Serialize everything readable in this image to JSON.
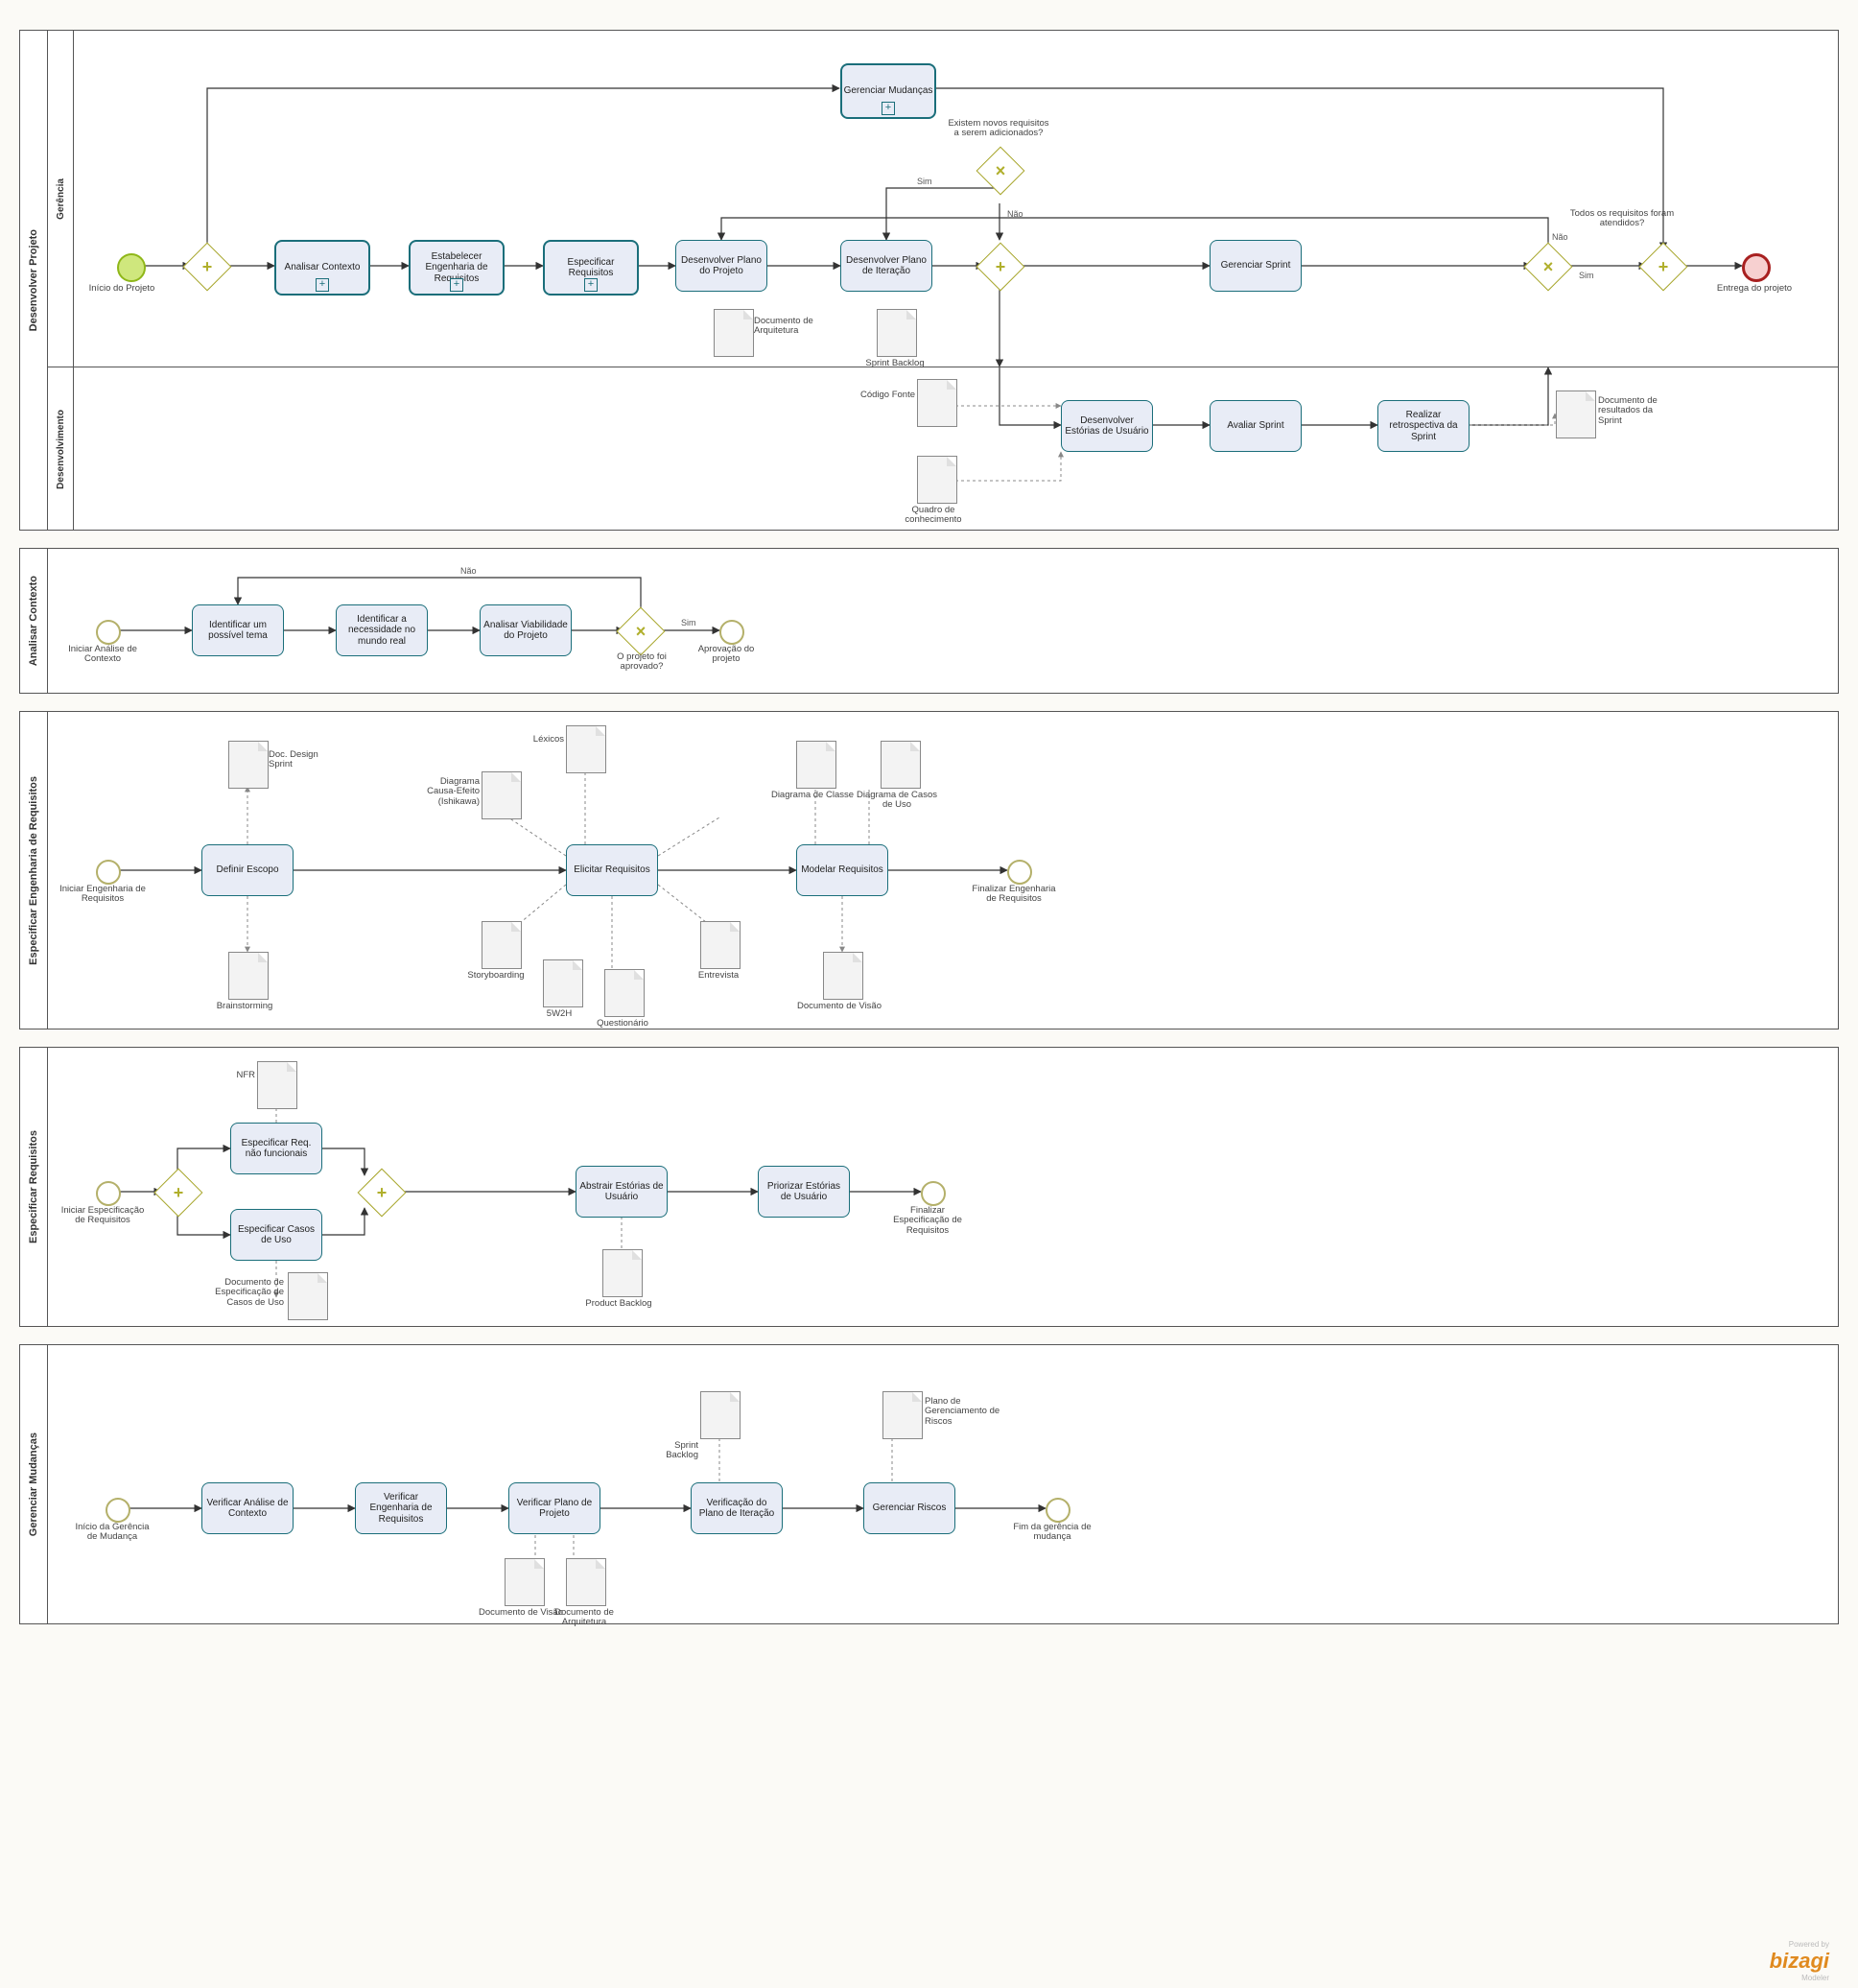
{
  "brand": {
    "name": "bizagi",
    "sub": "Modeler",
    "powered": "Powered by"
  },
  "pool1": {
    "title": "Desenvolver Projeto",
    "lanes": [
      "Gerência",
      "Desenvolvimento"
    ],
    "startLabel": "Início do Projeto",
    "endLabel": "Entrega do projeto",
    "q1": "Existem novos requisitos a serem adicionados?",
    "q2": "Todos os requisitos foram atendidos?",
    "sim": "Sim",
    "nao": "Não",
    "tasks": {
      "gm": "Gerenciar Mudanças",
      "ac": "Analisar Contexto",
      "eer": "Estabelecer Engenharia de Requisitos",
      "er": "Especificar Requisitos",
      "dpp": "Desenvolver Plano do Projeto",
      "dpi": "Desenvolver Plano de Iteração",
      "gs": "Gerenciar Sprint",
      "deu": "Desenvolver Estórias de Usuário",
      "as": "Avaliar Sprint",
      "rrs": "Realizar retrospectiva da Sprint"
    },
    "docs": {
      "arq": "Documento de Arquitetura",
      "sb": "Sprint Backlog",
      "cf": "Código Fonte",
      "qc": "Quadro de conhecimento",
      "drs": "Documento de resultados da Sprint"
    }
  },
  "pool2": {
    "title": "Analisar Contexto",
    "start": "Iniciar Análise de Contexto",
    "end": "Aprovação do projeto",
    "q": "O projeto foi aprovado?",
    "sim": "Sim",
    "nao": "Não",
    "t": {
      "a": "Identificar um possível tema",
      "b": "Identificar  a necessidade no mundo real",
      "c": "Analisar Viabilidade do Projeto"
    }
  },
  "pool3": {
    "title": "Especificar Engenharia de Requisitos",
    "start": "Iniciar Engenharia de Requisitos",
    "end": "Finalizar Engenharia de Requisitos",
    "t": {
      "de": "Definir Escopo",
      "er": "Elicitar Requisitos",
      "mr": "Modelar Requisitos"
    },
    "docs": {
      "dds": "Doc. Design Sprint",
      "bs": "Brainstorming",
      "lex": "Léxicos",
      "ish": "Diagrama Causa-Efeito (Ishikawa)",
      "sb": "Storyboarding",
      "w2h": "5W2H",
      "ent": "Entrevista",
      "que": "Questionário",
      "dc": "Diagrama de Classe",
      "dcu": "Diagrama de Casos de Uso",
      "dv": "Documento de Visão"
    }
  },
  "pool4": {
    "title": "Especificar Requisitos",
    "start": "Iniciar Especificação de Requisitos",
    "end": "Finalizar Especificação de Requisitos",
    "t": {
      "nf": "Especificar Req. não funcionais",
      "cu": "Especificar Casos de Uso",
      "aeu": "Abstrair Estórias de Usuário",
      "peu": "Priorizar Estórias de Usuário"
    },
    "docs": {
      "nfr": "NFR",
      "ecu": "Documento de Especificação de Casos de Uso",
      "pb": "Product Backlog"
    }
  },
  "pool5": {
    "title": "Gerenciar Mudanças",
    "start": "Início da Gerência de Mudança",
    "end": "Fim da gerência de mudança",
    "t": {
      "vac": "Verificar Análise de Contexto",
      "ver": "Verificar Engenharia de Requisitos",
      "vpp": "Verificar Plano de Projeto",
      "vpi": "Verificação do Plano de Iteração",
      "gr": "Gerenciar Riscos"
    },
    "docs": {
      "dv": "Documento de Visão",
      "da": "Documento de Arquitetura",
      "sb": "Sprint Backlog",
      "pgr": "Plano de Gerenciamento de Riscos"
    }
  }
}
